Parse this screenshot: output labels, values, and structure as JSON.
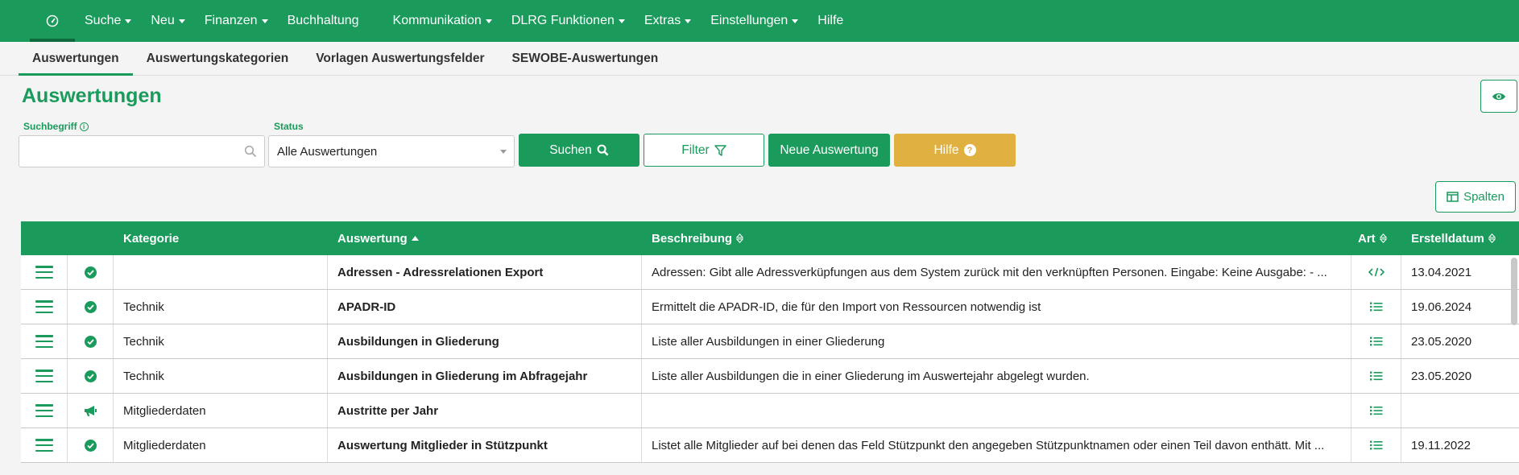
{
  "nav": {
    "items": [
      {
        "label": "Suche",
        "caret": true
      },
      {
        "label": "Neu",
        "caret": true
      },
      {
        "label": "Finanzen",
        "caret": true
      },
      {
        "label": "Buchhaltung",
        "caret": false
      },
      {
        "label": "Kommunikation",
        "caret": true
      },
      {
        "label": "DLRG Funktionen",
        "caret": true
      },
      {
        "label": "Extras",
        "caret": true
      },
      {
        "label": "Einstellungen",
        "caret": true
      },
      {
        "label": "Hilfe",
        "caret": false
      }
    ]
  },
  "tabs": [
    "Auswertungen",
    "Auswertungskategorien",
    "Vorlagen Auswertungsfelder",
    "SEWOBE-Auswertungen"
  ],
  "page": {
    "title": "Auswertungen"
  },
  "filters": {
    "search_label": "Suchbegriff",
    "search_value": "",
    "status_label": "Status",
    "status_value": "Alle Auswertungen"
  },
  "buttons": {
    "suchen": "Suchen",
    "filter": "Filter",
    "neu": "Neue Auswertung",
    "hilfe": "Hilfe",
    "spalten": "Spalten"
  },
  "colors": {
    "primary": "#1a9b5c",
    "help": "#e0b040"
  },
  "table": {
    "headers": {
      "kategorie": "Kategorie",
      "auswertung": "Auswertung",
      "beschreibung": "Beschreibung",
      "art": "Art",
      "erstelldatum": "Erstelldatum"
    },
    "rows": [
      {
        "status": "check",
        "kategorie": "",
        "auswertung": "Adressen - Adressrelationen Export",
        "beschreibung": "Adressen: Gibt alle Adressverküpfungen aus dem System zurück mit den verknüpften Personen. Eingabe: Keine Ausgabe: - ...",
        "art": "code",
        "datum": "13.04.2021"
      },
      {
        "status": "check",
        "kategorie": "Technik",
        "auswertung": "APADR-ID",
        "beschreibung": "Ermittelt die APADR-ID, die für den Import von Ressourcen notwendig ist",
        "art": "list",
        "datum": "19.06.2024"
      },
      {
        "status": "check",
        "kategorie": "Technik",
        "auswertung": "Ausbildungen in Gliederung",
        "beschreibung": "Liste aller Ausbildungen in einer Gliederung",
        "art": "list",
        "datum": "23.05.2020"
      },
      {
        "status": "check",
        "kategorie": "Technik",
        "auswertung": "Ausbildungen in Gliederung im Abfragejahr",
        "beschreibung": "Liste aller Ausbildungen die in einer Gliederung im Auswertejahr abgelegt wurden.",
        "art": "list",
        "datum": "23.05.2020"
      },
      {
        "status": "megaphone",
        "kategorie": "Mitgliederdaten",
        "auswertung": "Austritte per Jahr",
        "beschreibung": "",
        "art": "list",
        "datum": ""
      },
      {
        "status": "check",
        "kategorie": "Mitgliederdaten",
        "auswertung": "Auswertung Mitglieder in Stützpunkt",
        "beschreibung": "Listet alle Mitglieder auf bei denen das Feld Stützpunkt den angegeben Stützpunktnamen oder einen Teil davon enthätt. Mit ...",
        "art": "list",
        "datum": "19.11.2022"
      }
    ]
  }
}
